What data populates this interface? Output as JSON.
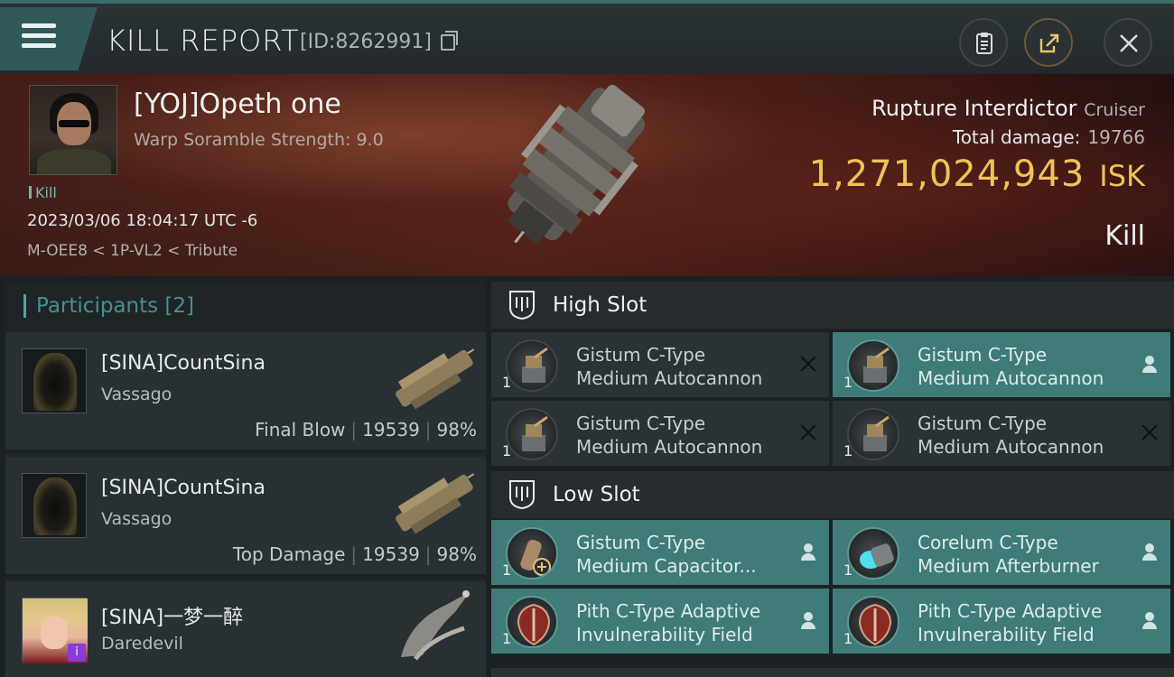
{
  "header": {
    "title": "KILL REPORT",
    "report_id": "[ID:8262991]"
  },
  "victim": {
    "name": "[YOJ]Opeth one",
    "scramble": "Warp Soramble Strength: 9.0",
    "kill_tag": "Kill",
    "datetime": "2023/03/06 18:04:17 UTC -6",
    "location": "M-OEE8 < 1P-VL2 < Tribute"
  },
  "ship": {
    "name": "Rupture Interdictor",
    "class": "Cruiser",
    "total_damage_label": "Total damage:",
    "total_damage": "19766",
    "isk_value": "1,271,024,943",
    "isk_unit": "ISK",
    "outcome": "Kill"
  },
  "participants": {
    "label": "Participants",
    "count": "[2]",
    "rows": [
      {
        "name": "[SINA]CountSina",
        "ship": "Vassago",
        "tag": "Final Blow",
        "damage": "19539",
        "pct": "98%"
      },
      {
        "name": "[SINA]CountSina",
        "ship": "Vassago",
        "tag": "Top Damage",
        "damage": "19539",
        "pct": "98%"
      },
      {
        "name": "[SINA]一梦一醉",
        "ship": "Daredevil",
        "badge": "i"
      }
    ]
  },
  "high_slot": {
    "label": "High Slot",
    "modules": [
      {
        "qty": "1",
        "line1": "Gistum C-Type",
        "line2": "Medium Autocannon",
        "status": "destroyed"
      },
      {
        "qty": "1",
        "line1": "Gistum C-Type",
        "line2": "Medium Autocannon",
        "status": "dropped"
      },
      {
        "qty": "1",
        "line1": "Gistum C-Type",
        "line2": "Medium Autocannon",
        "status": "destroyed"
      },
      {
        "qty": "1",
        "line1": "Gistum C-Type",
        "line2": "Medium Autocannon",
        "status": "destroyed"
      }
    ]
  },
  "low_slot": {
    "label": "Low Slot",
    "modules": [
      {
        "qty": "1",
        "line1": "Gistum C-Type",
        "line2": "Medium Capacitor...",
        "status": "dropped"
      },
      {
        "qty": "1",
        "line1": "Corelum C-Type",
        "line2": "Medium Afterburner",
        "status": "dropped"
      },
      {
        "qty": "1",
        "line1": "Pith C-Type Adaptive",
        "line2": "Invulnerability Field",
        "status": "dropped"
      },
      {
        "qty": "1",
        "line1": "Pith C-Type Adaptive",
        "line2": "Invulnerability Field",
        "status": "dropped"
      }
    ]
  },
  "colors": {
    "accent_teal": "#3f7b78",
    "isk_gold": "#f0c257",
    "module_dark": "#2b3236"
  }
}
